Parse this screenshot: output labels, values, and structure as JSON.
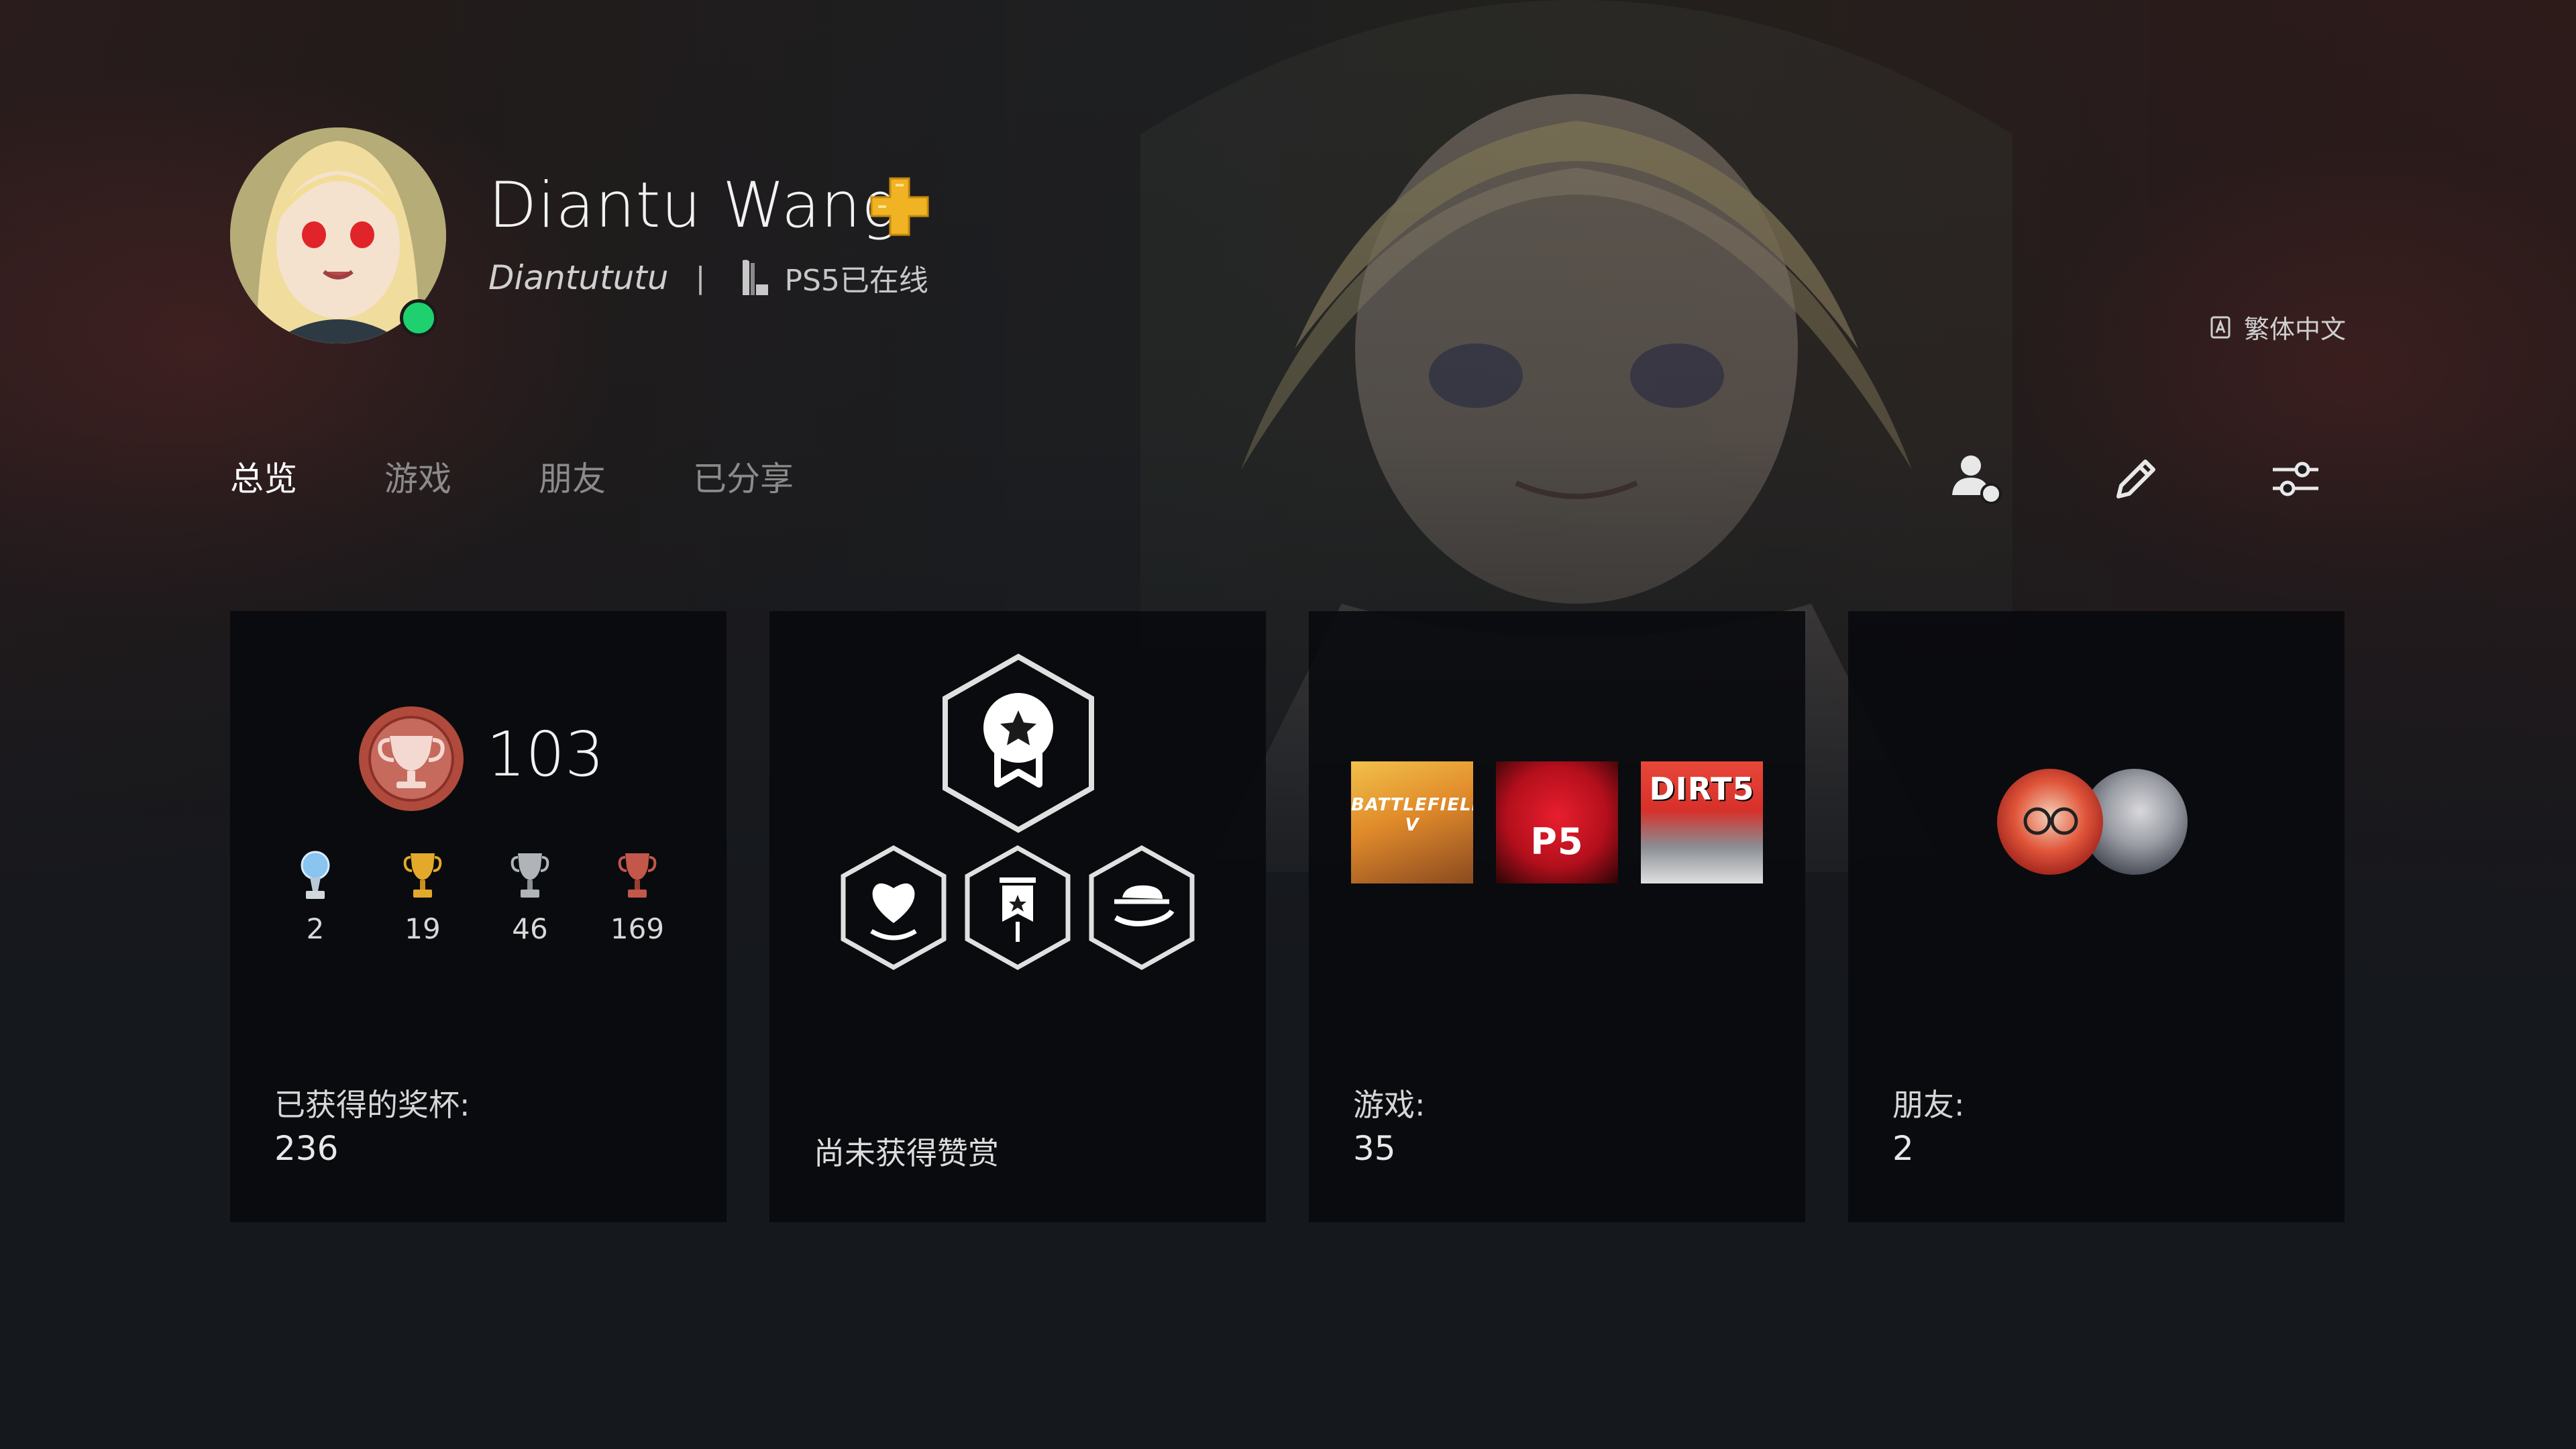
{
  "profile": {
    "name": "Diantu Wang",
    "online_id": "Diantututu",
    "separator": "|",
    "status": "PS5已在线",
    "online_color": "#1fd16e",
    "plus_color": "#f0b323"
  },
  "language": {
    "label": "繁体中文"
  },
  "tabs": [
    {
      "label": "总览",
      "active": true
    },
    {
      "label": "游戏",
      "active": false
    },
    {
      "label": "朋友",
      "active": false
    },
    {
      "label": "已分享",
      "active": false
    }
  ],
  "toolbar": {
    "icons": [
      "friend-request-icon",
      "edit-icon",
      "settings-sliders-icon"
    ]
  },
  "trophies": {
    "level": "103",
    "platinum": "2",
    "gold": "19",
    "silver": "46",
    "bronze": "169",
    "label": "已获得的奖杯:",
    "total": "236"
  },
  "badges": {
    "label": "尚未获得赞赏",
    "icons": [
      "star-ribbon-badge-icon",
      "heart-hand-badge-icon",
      "banner-badge-icon",
      "hat-hand-badge-icon"
    ]
  },
  "games": {
    "label": "游戏:",
    "count": "35",
    "tiles": [
      {
        "title": "BATTLEFIELD V",
        "color": "#e08a2a"
      },
      {
        "title": "P5",
        "color": "#c8102e"
      },
      {
        "title": "DIRT5",
        "color": "#d7302a"
      }
    ]
  },
  "friends": {
    "label": "朋友:",
    "count": "2"
  }
}
